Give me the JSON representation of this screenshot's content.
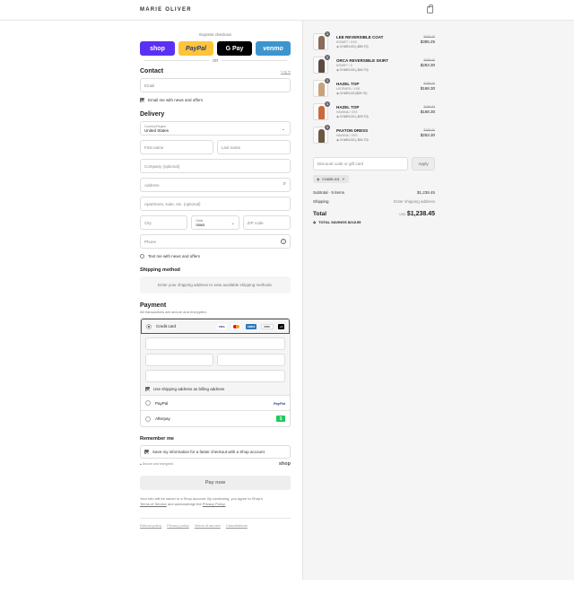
{
  "header": {
    "logo": "MARIE OLIVER"
  },
  "express": {
    "title": "Express checkout",
    "buttons": [
      {
        "label": "shop",
        "color": "#5a31f4"
      },
      {
        "label": "PayPal",
        "color": "#ffc439"
      },
      {
        "label": "G Pay",
        "color": "#000000"
      },
      {
        "label": "venmo",
        "color": "#3d95ce"
      }
    ],
    "or": "OR"
  },
  "contact": {
    "title": "Contact",
    "login": "Log in",
    "email_placeholder": "Email",
    "news": "Email me with news and offers"
  },
  "delivery": {
    "title": "Delivery",
    "country_label": "Country/Region",
    "country_value": "United States",
    "first": "First name",
    "last": "Last name",
    "company": "Company (optional)",
    "address": "Address",
    "apartment": "Apartment, suite, etc. (optional)",
    "city": "City",
    "state_label": "State",
    "state_value": "Iowa",
    "zip": "ZIP code",
    "phone": "Phone",
    "text_me": "Text me with news and offers"
  },
  "shipping": {
    "title": "Shipping method",
    "message": "Enter your shipping address to view available shipping methods."
  },
  "payment": {
    "title": "Payment",
    "subtitle": "All transactions are secure and encrypted.",
    "credit": "Credit card",
    "more_cards": "+4",
    "billing": "Use shipping address as billing address",
    "paypal": "PayPal",
    "afterpay": "Afterpay"
  },
  "remember": {
    "title": "Remember me",
    "save": "Save my information for a faster checkout with a Shop account",
    "secure": "Secure and encrypted",
    "shop": "shop"
  },
  "pay_now": "Pay now",
  "legal": {
    "text": "Your info will be saved to a Shop account. By continuing, you agree to Shop's",
    "tos": "Terms of Service",
    "and": "and acknowledge the",
    "privacy": "Privacy Policy."
  },
  "footer": [
    "Refund policy",
    "Privacy policy",
    "Terms of service",
    "Cancellations"
  ],
  "cart": {
    "items": [
      {
        "qty": "1",
        "name": "LEE REVERSIBLE COAT",
        "variant": "KISMET / XXS",
        "code": "CHARLI15 (-$89.70)",
        "orig": "$485.00",
        "price": "$395.25",
        "color": "#8a6a58"
      },
      {
        "qty": "1",
        "name": "ORCA REVERSIBLE SKIRT",
        "variant": "KISMET / 0",
        "code": "CHARLI15 (-$44.70)",
        "orig": "$298.00",
        "price": "$253.30",
        "color": "#5d4a40"
      },
      {
        "qty": "1",
        "name": "HAZEL TOP",
        "variant": "LEOPARD / XXS",
        "code": "CHARLI15 ($29.70)",
        "orig": "$198.00",
        "price": "$168.30",
        "color": "#c9a27a"
      },
      {
        "qty": "1",
        "name": "HAZEL TOP",
        "variant": "HAVANA / XXS",
        "code": "CHARLI15 (-$29.70)",
        "orig": "$198.00",
        "price": "$168.30",
        "color": "#c96a3e"
      },
      {
        "qty": "1",
        "name": "PAXTON DRESS",
        "variant": "HAVANA / XXS",
        "code": "CHARLI15 (-$44.70)",
        "orig": "$298.00",
        "price": "$253.30",
        "color": "#6b5a42"
      }
    ],
    "discount_placeholder": "Discount code or gift card",
    "apply": "Apply",
    "applied_code": "CHARLI15",
    "subtotal_label": "Subtotal · 5 items",
    "subtotal": "$1,238.45",
    "shipping_label": "Shipping",
    "shipping_value": "Enter shipping address",
    "total_label": "Total",
    "currency": "USD",
    "total": "$1,238.45",
    "savings": "TOTAL SAVINGS $218.55"
  }
}
